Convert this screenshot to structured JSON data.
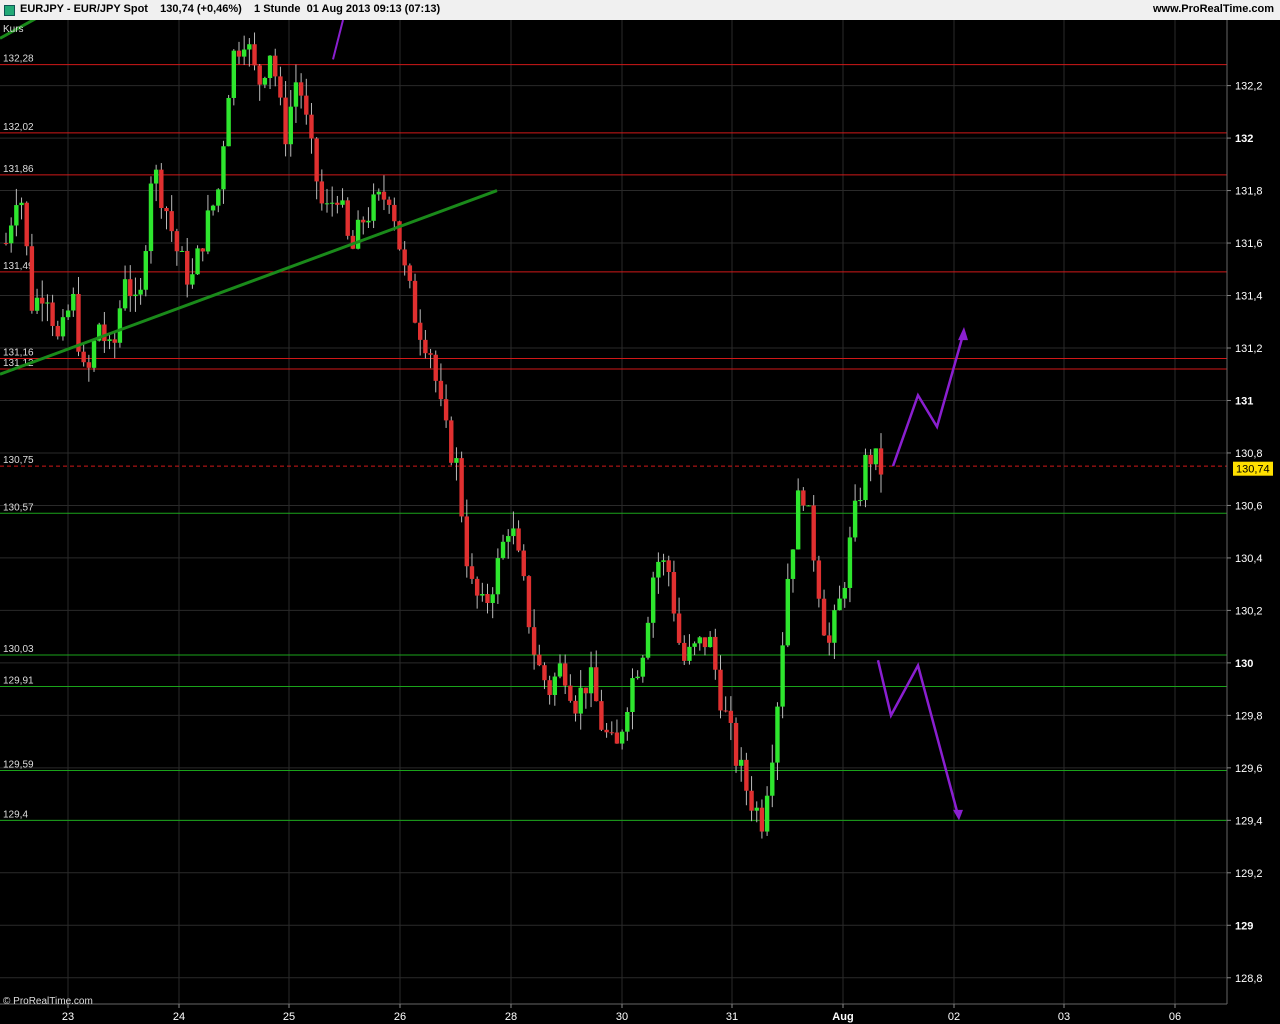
{
  "header": {
    "title": "EURJPY - EUR/JPY Spot    130,74 (+0,46%)    1 Stunde  01 Aug 2013 09:13 (07:13)",
    "site": "www.ProRealTime.com"
  },
  "footer": {
    "watermark": "© ProRealTime.com"
  },
  "panel_label": "Kurs",
  "colors": {
    "up": "#2ee62e",
    "down": "#e03030",
    "support": "#1aa31a",
    "resistance": "#d01818",
    "trend": "#1a8a1a",
    "projection": "#8a1fd0",
    "grid": "#2a2a2a",
    "price_tag": "#ffe000"
  },
  "chart_data": {
    "type": "candlestick",
    "symbol": "EURJPY",
    "timeframe": "1 Stunde",
    "last_price": "130,74",
    "ylim": [
      128.7,
      132.45
    ],
    "y_ticks": [
      "128,8",
      "129",
      "129,2",
      "129,4",
      "129,6",
      "129,8",
      "130",
      "130,2",
      "130,4",
      "130,6",
      "130,8",
      "131",
      "131,2",
      "131,4",
      "131,6",
      "131,8",
      "132",
      "132,2"
    ],
    "x_ticks": [
      "23",
      "24",
      "25",
      "26",
      "28",
      "30",
      "31",
      "Aug",
      "02",
      "03",
      "06"
    ],
    "resistance_levels": [
      "132,28",
      "132,02",
      "131,86",
      "131,49",
      "131,16",
      "131,12"
    ],
    "support_levels": [
      "130,75",
      "130,57",
      "130,03",
      "129,91",
      "129,59",
      "129,4"
    ],
    "price_path": [
      131.6,
      131.85,
      131.35,
      131.45,
      131.2,
      131.4,
      131.05,
      131.3,
      131.15,
      131.5,
      131.3,
      131.9,
      131.75,
      131.55,
      131.45,
      131.65,
      131.8,
      132.3,
      132.4,
      132.2,
      132.35,
      132.0,
      132.25,
      131.95,
      131.7,
      131.8,
      131.55,
      131.7,
      131.75,
      131.8,
      131.5,
      131.3,
      131.2,
      130.9,
      130.75,
      130.3,
      130.2,
      130.35,
      130.55,
      130.3,
      130.0,
      129.9,
      130.0,
      129.85,
      129.95,
      129.75,
      129.65,
      129.9,
      130.05,
      130.4,
      130.35,
      130.0,
      130.05,
      130.1,
      129.85,
      129.65,
      129.5,
      129.4,
      129.75,
      130.35,
      130.7,
      130.4,
      130.05,
      130.25,
      130.55,
      130.8,
      130.74
    ]
  }
}
